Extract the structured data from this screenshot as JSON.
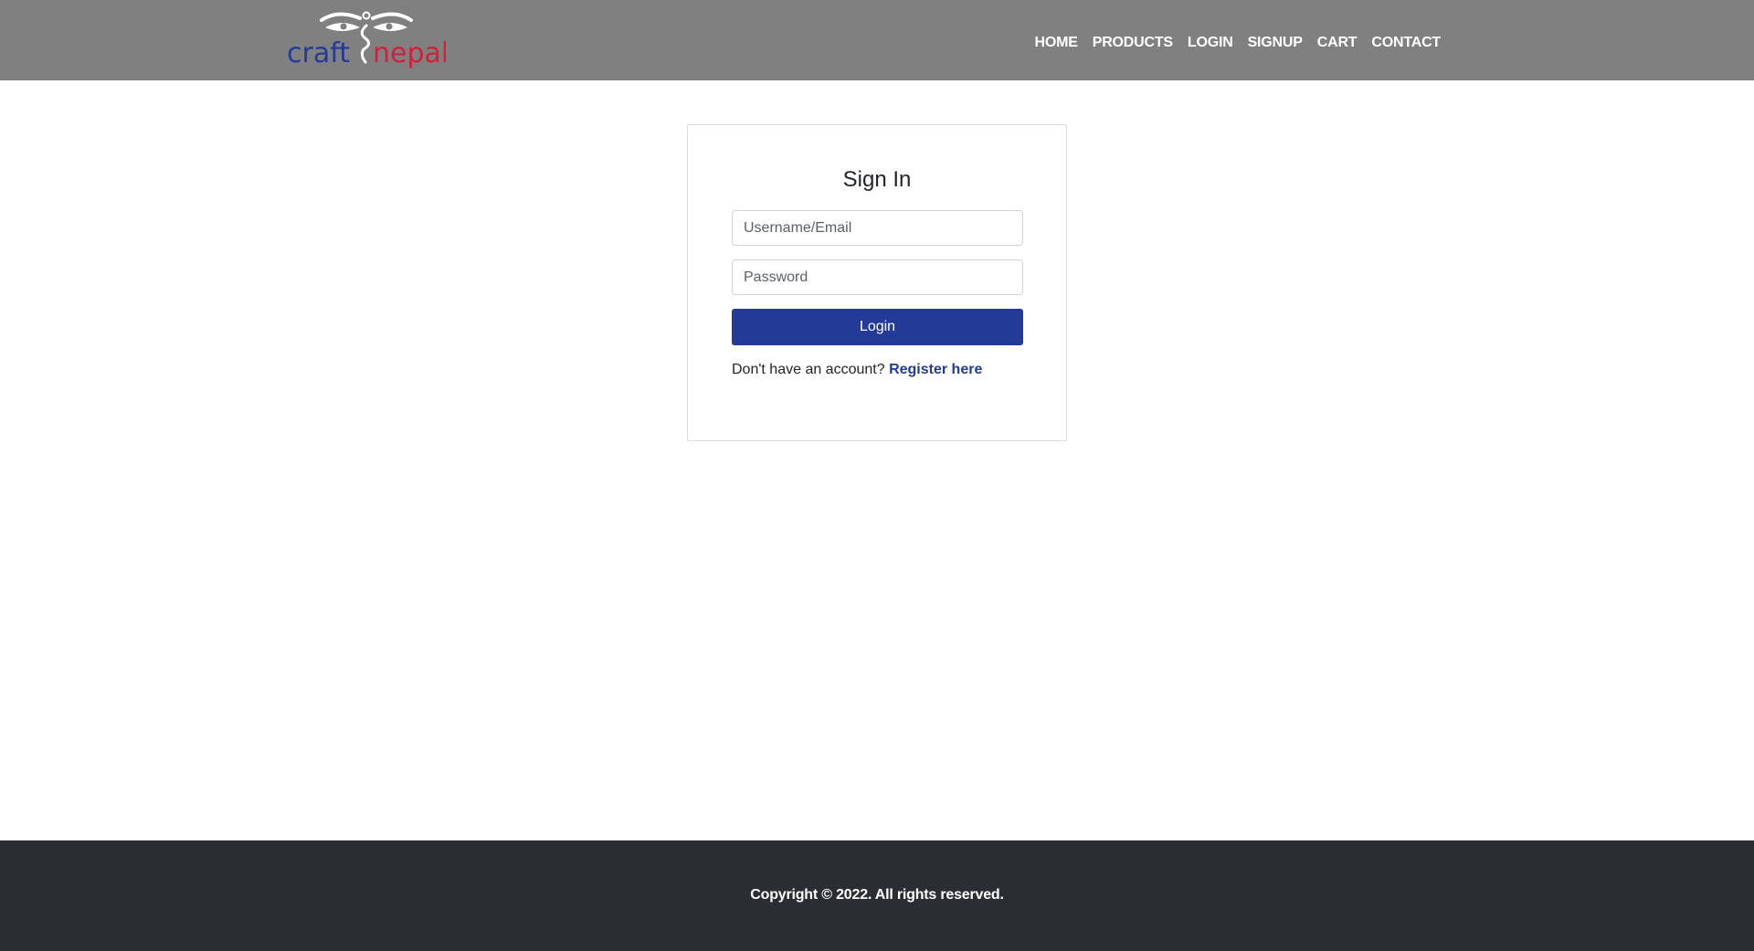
{
  "header": {
    "logo": {
      "word1": "craft",
      "word2": "nepal",
      "word1_color": "#233a97",
      "word2_color": "#d21f3c",
      "icon": "buddha-eyes-icon"
    },
    "nav": [
      {
        "label": "HOME"
      },
      {
        "label": "PRODUCTS"
      },
      {
        "label": "LOGIN"
      },
      {
        "label": "SIGNUP"
      },
      {
        "label": "CART"
      },
      {
        "label": "CONTACT"
      }
    ],
    "background_color": "#808080"
  },
  "login_card": {
    "title": "Sign In",
    "username_placeholder": "Username/Email",
    "username_value": "",
    "password_placeholder": "Password",
    "password_value": "",
    "submit_label": "Login",
    "register_prompt": "Don't have an account?",
    "register_link": "Register here",
    "accent_color": "#233a97"
  },
  "footer": {
    "copyright": "Copyright © 2022. All rights reserved.",
    "background_color": "#292e32"
  }
}
